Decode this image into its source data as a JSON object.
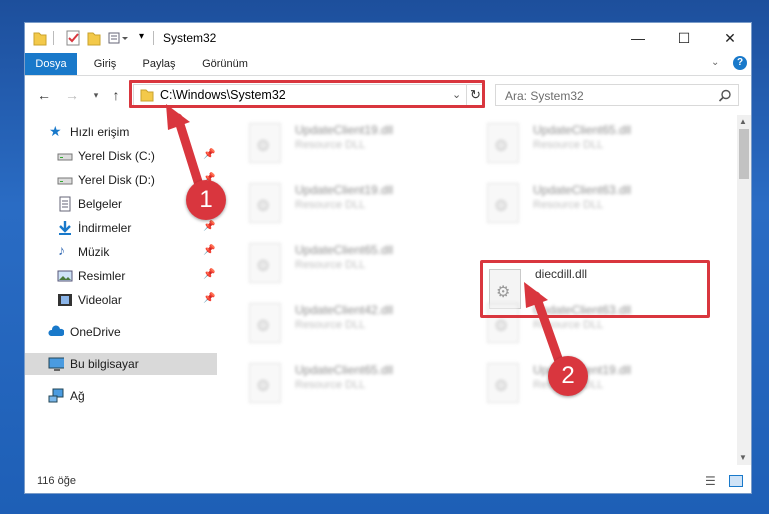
{
  "window": {
    "title": "System32",
    "controls": {
      "minimize": "—",
      "maximize": "☐",
      "close": "✕"
    }
  },
  "ribbon": {
    "tabs": [
      {
        "label": "Dosya",
        "active": true
      },
      {
        "label": "Giriş",
        "active": false
      },
      {
        "label": "Paylaş",
        "active": false
      },
      {
        "label": "Görünüm",
        "active": false
      }
    ]
  },
  "nav": {
    "address": "C:\\Windows\\System32",
    "search_placeholder": "Ara: System32"
  },
  "sidebar": {
    "items": [
      {
        "label": "Hızlı erişim",
        "icon": "star-icon",
        "pinned": false
      },
      {
        "label": "Yerel Disk (C:)",
        "icon": "drive-icon",
        "pinned": true
      },
      {
        "label": "Yerel Disk (D:)",
        "icon": "drive-icon",
        "pinned": true
      },
      {
        "label": "Belgeler",
        "icon": "documents-icon",
        "pinned": true
      },
      {
        "label": "İndirmeler",
        "icon": "download-icon",
        "pinned": true
      },
      {
        "label": "Müzik",
        "icon": "music-icon",
        "pinned": true
      },
      {
        "label": "Resimler",
        "icon": "pictures-icon",
        "pinned": true
      },
      {
        "label": "Videolar",
        "icon": "video-icon",
        "pinned": true
      },
      {
        "label": "OneDrive",
        "icon": "cloud-icon",
        "pinned": false
      },
      {
        "label": "Bu bilgisayar",
        "icon": "computer-icon",
        "pinned": false,
        "selected": true
      },
      {
        "label": "Ağ",
        "icon": "network-icon",
        "pinned": false
      }
    ]
  },
  "files": [
    {
      "name": "UpdateClient19.dll",
      "type": "Resource DLL",
      "blurred": true
    },
    {
      "name": "UpdateClient65.dll",
      "type": "Resource DLL",
      "blurred": true
    },
    {
      "name": "UpdateClient19.dll",
      "type": "Resource DLL",
      "blurred": true
    },
    {
      "name": "UpdateClient63.dll",
      "type": "Resource DLL",
      "blurred": true
    },
    {
      "name": "UpdateClient65.dll",
      "type": "Resource DLL",
      "blurred": true
    },
    {
      "name": "diecdill.dll",
      "type": "",
      "blurred": false
    },
    {
      "name": "UpdateClient42.dll",
      "type": "Resource DLL",
      "blurred": true
    },
    {
      "name": "UpdateClient63.dll",
      "type": "Resource DLL",
      "blurred": true
    },
    {
      "name": "UpdateClient65.dll",
      "type": "Resource DLL",
      "blurred": true
    },
    {
      "name": "UpdateClient19.dll",
      "type": "Resource DLL",
      "blurred": true
    }
  ],
  "status": {
    "count": "116 öğe"
  },
  "callouts": {
    "one": "1",
    "two": "2"
  },
  "colors": {
    "accent": "#1979ca",
    "highlight": "#d9363e",
    "desktop": "#1e5fb6"
  }
}
